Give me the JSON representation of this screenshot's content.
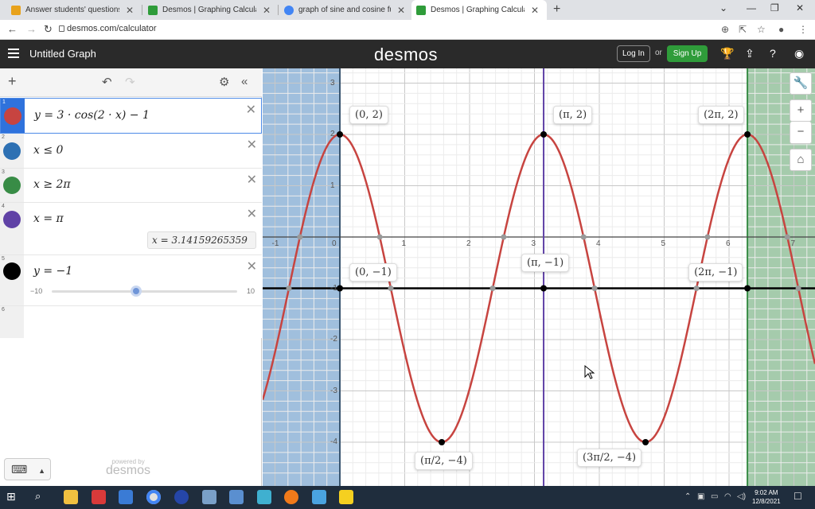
{
  "browser": {
    "tabs": [
      {
        "label": "Answer students' questions and ",
        "favicon_color": "#e8a21c"
      },
      {
        "label": "Desmos | Graphing Calculator",
        "favicon_color": "#2f9c3a"
      },
      {
        "label": "graph of sine and cosine functio",
        "favicon_color": "#4285f4"
      },
      {
        "label": "Desmos | Graphing Calculator",
        "favicon_color": "#2f9c3a"
      }
    ],
    "url": "desmos.com/calculator"
  },
  "header": {
    "title": "Untitled Graph",
    "logo": "desmos",
    "login": "Log In",
    "or": "or",
    "signup": "Sign Up"
  },
  "expressions": [
    {
      "num": "1",
      "latex": "y  =  3  ·  cos(2  ·  x) − 1",
      "color": "#c74440",
      "icon": "wave-icon"
    },
    {
      "num": "2",
      "latex": "x  ≤  0",
      "color": "#2d70b3",
      "icon": "brush-icon"
    },
    {
      "num": "3",
      "latex": "x  ≥  2π",
      "color": "#388c46",
      "icon": "brush-icon"
    },
    {
      "num": "4",
      "latex": "x = π",
      "color": "#6042a6",
      "icon": "wave-icon",
      "eval": "x  =  3.14159265359"
    },
    {
      "num": "5",
      "latex": "y = −1",
      "color": "#000000",
      "icon": "wave-icon",
      "slider_min": "−10",
      "slider_max": "10"
    },
    {
      "num": "6",
      "latex": ""
    }
  ],
  "powered_by": {
    "small": "powered by",
    "big": "desmos"
  },
  "graph": {
    "x_ticks": [
      "-1",
      "0",
      "1",
      "2",
      "3",
      "4",
      "5",
      "6",
      "7"
    ],
    "y_ticks": [
      "3",
      "2",
      "1",
      "-1",
      "-2",
      "-3",
      "-4"
    ],
    "point_labels": [
      "(0, 2)",
      "(π, 2)",
      "(2π, 2)",
      "(0, −1)",
      "(π, −1)",
      "(2π, −1)",
      "(π/2, −4)",
      "(3π/2, −4)"
    ]
  },
  "chart_data": {
    "type": "line",
    "xlim": [
      -1.2,
      7.3
    ],
    "ylim": [
      -4.7,
      3.3
    ],
    "series": [
      {
        "name": "y = 3 · cos(2 · x) − 1",
        "function": "3*cos(2*x)-1",
        "color": "#c74440"
      },
      {
        "name": "y = −1",
        "function": "-1",
        "color": "#000000"
      }
    ],
    "vertical_lines": [
      {
        "name": "x = π",
        "x": 3.14159265359,
        "color": "#6042a6"
      }
    ],
    "shaded_regions": [
      {
        "name": "x ≤ 0",
        "x_to": 0,
        "color": "#2d70b3"
      },
      {
        "name": "x ≥ 2π",
        "x_from": 6.28318530718,
        "color": "#388c46"
      }
    ],
    "labeled_points": [
      {
        "label": "(0, 2)",
        "x": 0,
        "y": 2
      },
      {
        "label": "(π, 2)",
        "x": 3.14159265359,
        "y": 2
      },
      {
        "label": "(2π, 2)",
        "x": 6.28318530718,
        "y": 2
      },
      {
        "label": "(0, −1)",
        "x": 0,
        "y": -1
      },
      {
        "label": "(π, −1)",
        "x": 3.14159265359,
        "y": -1
      },
      {
        "label": "(2π, −1)",
        "x": 6.28318530718,
        "y": -1
      },
      {
        "label": "(π/2, −4)",
        "x": 1.57079632679,
        "y": -4
      },
      {
        "label": "(3π/2, −4)",
        "x": 4.71238898038,
        "y": -4
      }
    ],
    "grid": true
  },
  "taskbar": {
    "time": "9:02 AM",
    "date": "12/8/2021"
  }
}
